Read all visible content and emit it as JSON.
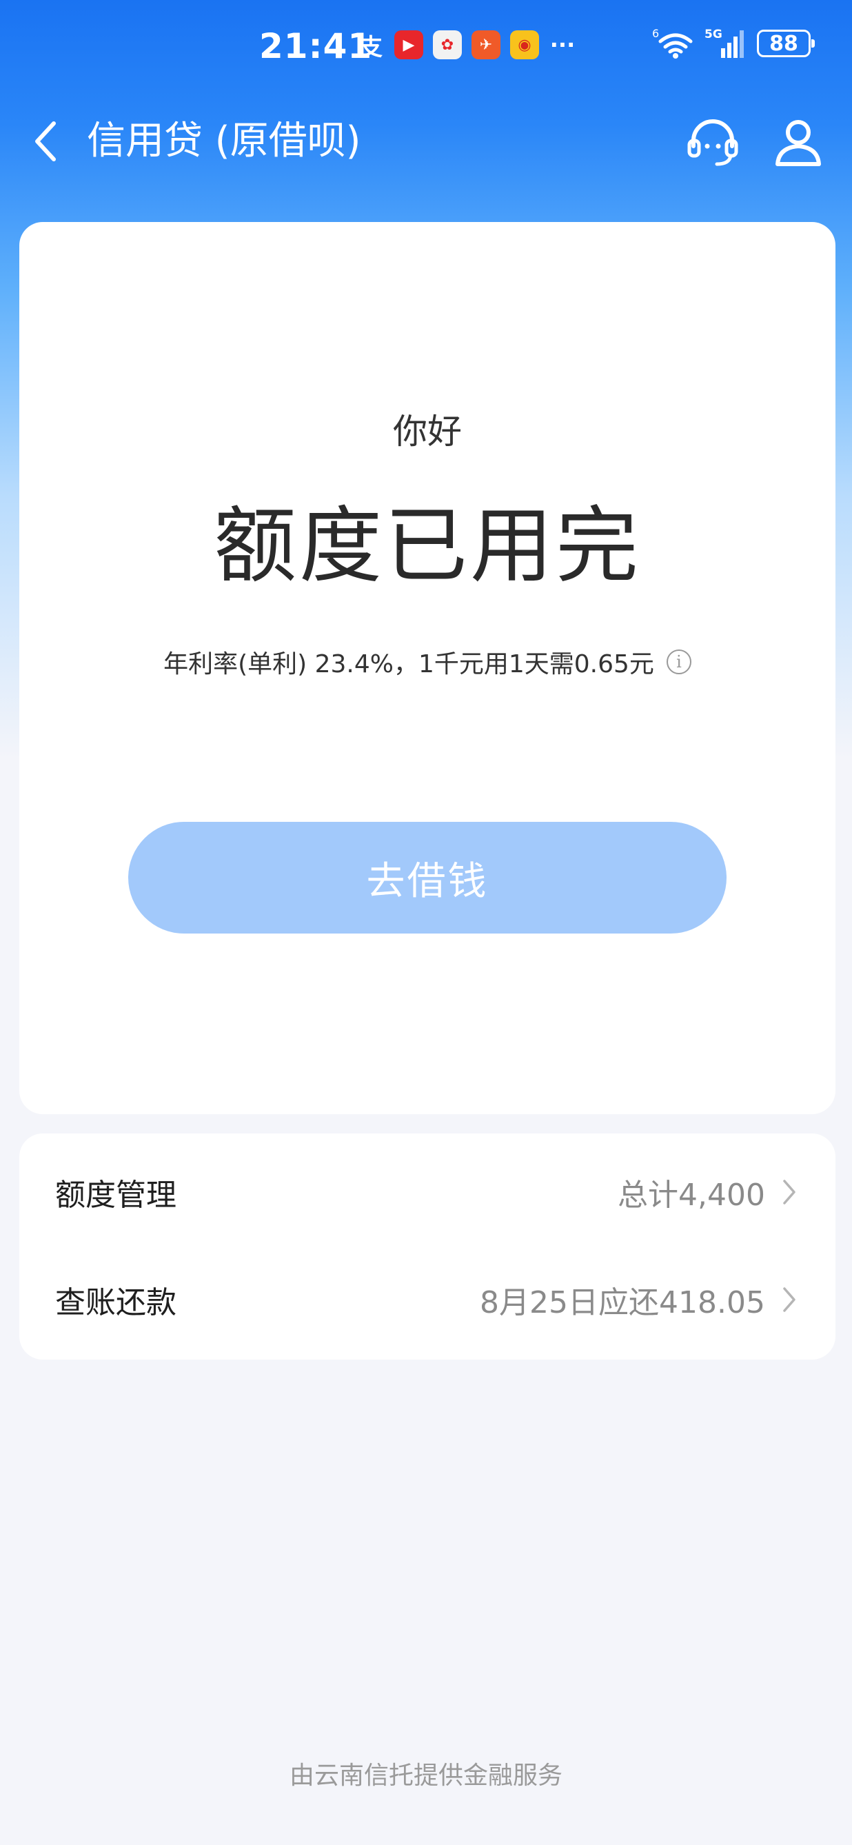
{
  "status_bar": {
    "time": "21:41",
    "notifications": [
      {
        "icon": "alipay-icon",
        "glyph": "支"
      },
      {
        "icon": "video-app-icon",
        "glyph": "▶"
      },
      {
        "icon": "game-app-icon",
        "glyph": "✿"
      },
      {
        "icon": "paper-plane-app-icon",
        "glyph": "✈"
      },
      {
        "icon": "weibo-icon",
        "glyph": "◉"
      },
      {
        "icon": "more-dots-icon",
        "glyph": "···"
      }
    ],
    "wifi_label": "6",
    "cellular_label": "5G",
    "battery": "88"
  },
  "nav": {
    "title": "信用贷 (原借呗)"
  },
  "main": {
    "greeting": "你好",
    "quota_status": "额度已用完",
    "rate_text": "年利率(单利) 23.4%，1千元用1天需0.65元",
    "info_glyph": "i",
    "borrow_button": "去借钱"
  },
  "list": [
    {
      "label": "额度管理",
      "value": "总计4,400"
    },
    {
      "label": "查账还款",
      "value": "8月25日应还418.05"
    }
  ],
  "footer": "由云南信托提供金融服务",
  "colors": {
    "brand_blue": "#1a73f2",
    "button_disabled": "#a2c9fb",
    "page_bg": "#f4f5fa"
  }
}
